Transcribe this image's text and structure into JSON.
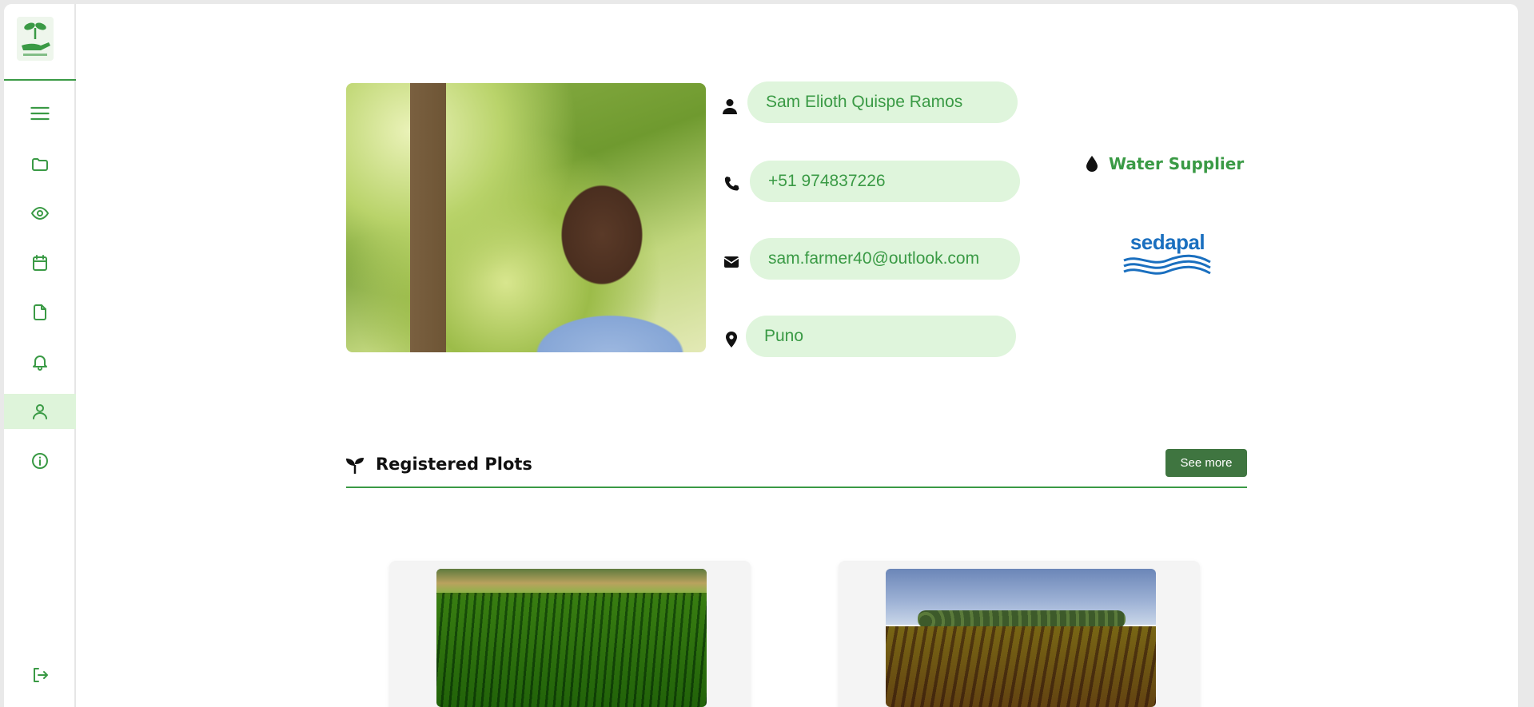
{
  "sidebar": {
    "logo_icon": "sprout-hand-logo-icon",
    "items": [
      {
        "name": "menu",
        "icon": "hamburger-menu-icon"
      },
      {
        "name": "folder",
        "icon": "folder-icon"
      },
      {
        "name": "view",
        "icon": "eye-icon"
      },
      {
        "name": "calendar",
        "icon": "calendar-icon"
      },
      {
        "name": "document",
        "icon": "file-icon"
      },
      {
        "name": "notifications",
        "icon": "bell-icon"
      },
      {
        "name": "profile",
        "icon": "user-icon",
        "active": true
      },
      {
        "name": "info",
        "icon": "info-icon"
      },
      {
        "name": "logout",
        "icon": "logout-icon"
      }
    ]
  },
  "profile": {
    "name": "Sam Elioth Quispe Ramos",
    "phone": "+51 974837226",
    "email": "sam.farmer40@outlook.com",
    "location": "Puno",
    "role": "Water Supplier",
    "organization": "sedapal"
  },
  "plots_section": {
    "title": "Registered Plots",
    "see_more_label": "See more"
  },
  "colors": {
    "accent": "#3a9a45",
    "field_bg": "#dff5dc",
    "button_bg": "#3f7540",
    "org_blue": "#1a6fbf"
  }
}
